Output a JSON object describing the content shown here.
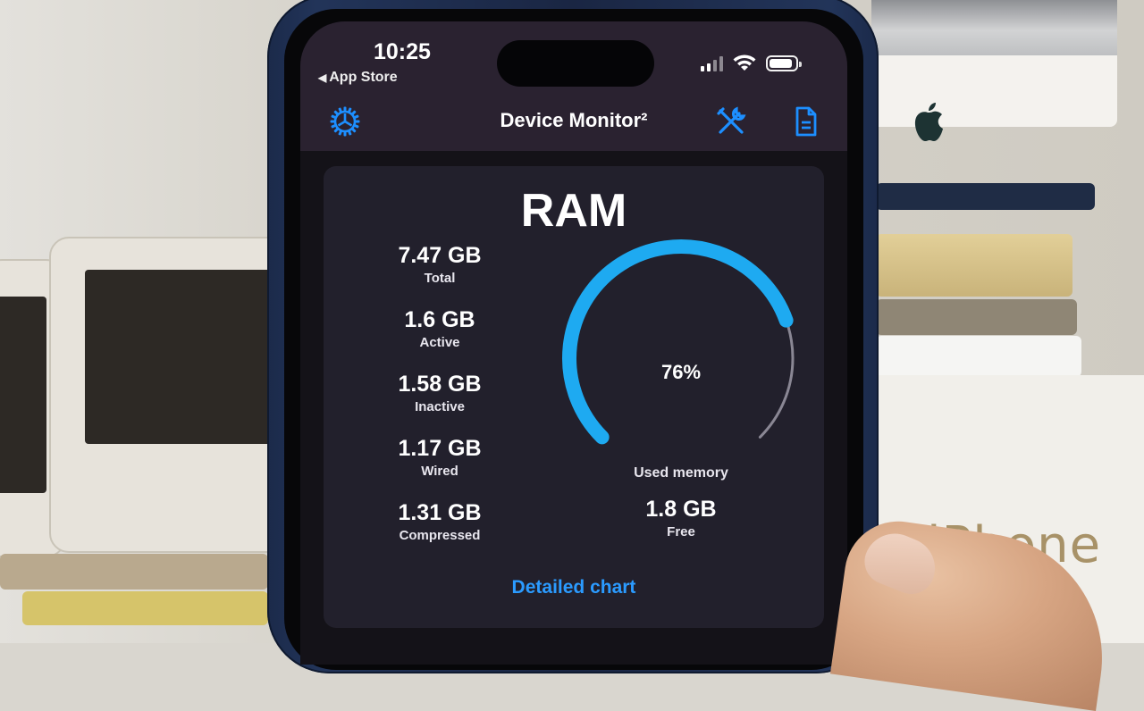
{
  "status_bar": {
    "time": "10:25",
    "back_label": "App Store",
    "signal_bars_active": 2,
    "signal_bars_total": 4,
    "battery_level_percent": 90
  },
  "nav": {
    "title": "Device Monitor²",
    "left_icon": "gear-icon",
    "right_icons": [
      "tools-icon",
      "document-icon"
    ]
  },
  "ram_card": {
    "title": "RAM",
    "stats": [
      {
        "value": "7.47 GB",
        "label": "Total"
      },
      {
        "value": "1.6 GB",
        "label": "Active"
      },
      {
        "value": "1.58 GB",
        "label": "Inactive"
      },
      {
        "value": "1.17 GB",
        "label": "Wired"
      },
      {
        "value": "1.31 GB",
        "label": "Compressed"
      }
    ],
    "gauge": {
      "percent_text": "76%",
      "percent_value": 76,
      "label": "Used memory"
    },
    "free": {
      "value": "1.8 GB",
      "label": "Free"
    },
    "detail_link": "Detailed chart"
  },
  "colors": {
    "accent": "#2b9bff",
    "gauge_fill": "#1eaaf1",
    "gauge_track": "#8a8794",
    "card_bg": "#22202c",
    "topbar_bg": "#2a2230"
  },
  "background": {
    "box_text": "iPhone"
  }
}
